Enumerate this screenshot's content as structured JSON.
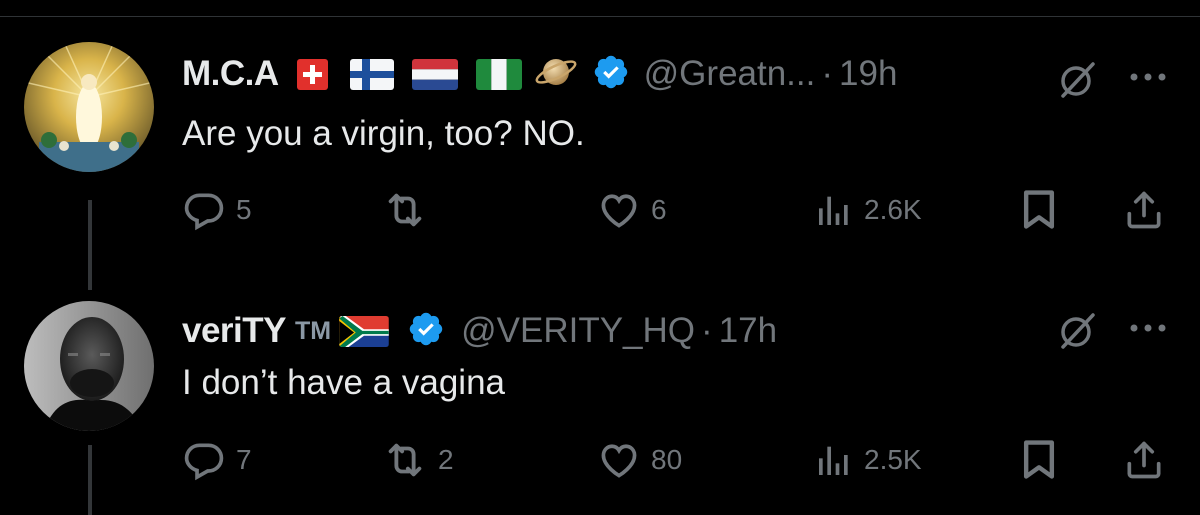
{
  "tweets": [
    {
      "display_name": "M.C.A",
      "badges": [
        "swiss-flag",
        "finland-flag",
        "netherlands-flag",
        "nigeria-flag",
        "saturn-emoji"
      ],
      "verified": true,
      "handle": "@Greatn...",
      "separator": "·",
      "time": "19h",
      "text": "Are you a virgin, too? NO.",
      "replies": "5",
      "retweets": "",
      "likes": "6",
      "views": "2.6K"
    },
    {
      "display_name": "veriTY",
      "tm": "TM",
      "badges": [
        "south-africa-flag"
      ],
      "verified": true,
      "handle": "@VERITY_HQ",
      "separator": "·",
      "time": "17h",
      "text": "I don’t have a vagina",
      "replies": "7",
      "retweets": "2",
      "likes": "80",
      "views": "2.5K"
    }
  ],
  "colors": {
    "background": "#000000",
    "text": "#e7e9ea",
    "muted": "#71767b",
    "verified": "#1d9bf0",
    "divider": "#2f3336"
  }
}
